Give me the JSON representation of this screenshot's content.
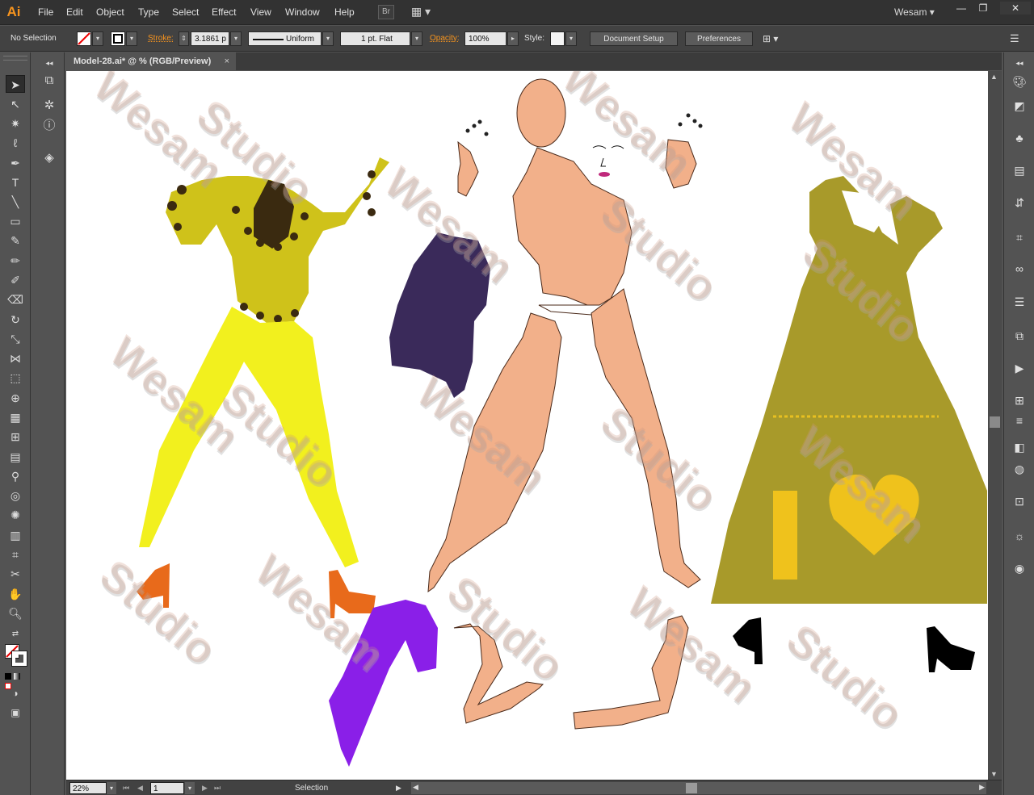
{
  "app": {
    "logo": "Ai",
    "workspace": "Wesam"
  },
  "menu": [
    "File",
    "Edit",
    "Object",
    "Type",
    "Select",
    "Effect",
    "View",
    "Window",
    "Help"
  ],
  "menubar_buttons": {
    "bridge": "Br",
    "arrange": "▦"
  },
  "window_controls": {
    "minimize": "—",
    "restore": "❐",
    "close": "✕"
  },
  "control_bar": {
    "selection_status": "No Selection",
    "stroke_label": "Stroke:",
    "stroke_weight": "3.1861 p",
    "profile": "Uniform",
    "brush": "1 pt. Flat",
    "opacity_label": "Opacity:",
    "opacity_value": "100%",
    "style_label": "Style:",
    "document_setup": "Document Setup",
    "preferences": "Preferences"
  },
  "document": {
    "tab_title": "Model-28.ai* @ % (RGB/Preview)",
    "close_glyph": "×"
  },
  "status_bar": {
    "zoom": "22%",
    "artboard_number": "1",
    "tool_status": "Selection"
  },
  "artwork": {
    "watermark_line1": "Wesam",
    "watermark_line2": "Studio",
    "dress_letter": "I",
    "colors": {
      "skin": "#f2b08a",
      "yellow_top": "#cfc21a",
      "yellow_pants": "#f2f01e",
      "olive_dress": "#a89a2a",
      "heart_gold": "#efc21c",
      "orange_shoe": "#e86a1b",
      "purple_hair": "#8a1fe8",
      "dark_hair": "#3a2a5a",
      "black_shoe": "#000000"
    }
  }
}
